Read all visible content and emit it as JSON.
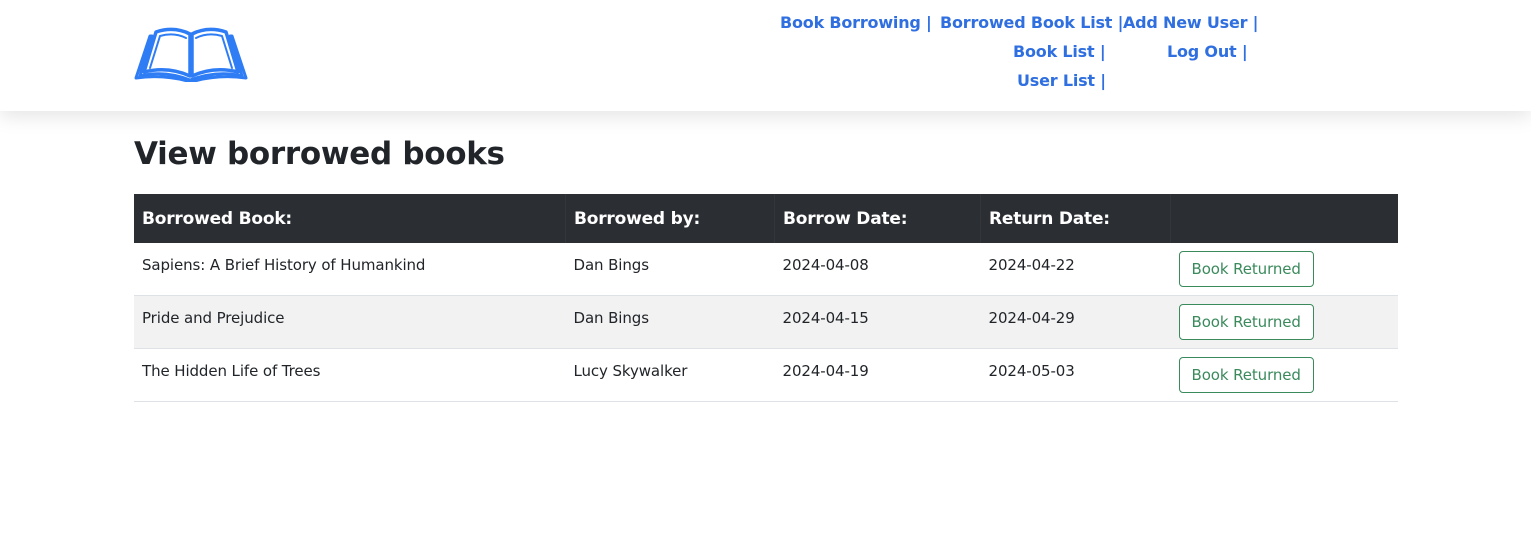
{
  "colors": {
    "nav_link": "#2f6fe0",
    "logo": "#2f7df5",
    "table_header_bg": "#2b2f33",
    "button_border": "#3a8a5c"
  },
  "header": {
    "logo_icon": "open-book-icon",
    "nav": {
      "book_borrowing": "Book Borrowing |",
      "borrowed_book_list": "Borrowed Book List |",
      "add_new_user": "Add New User |",
      "book_list": "Book List |",
      "log_out": "Log Out |",
      "user_list": "User List |"
    }
  },
  "page": {
    "title": "View borrowed books"
  },
  "table": {
    "headers": {
      "book": "Borrowed Book:",
      "borrowed_by": "Borrowed by:",
      "borrow_date": "Borrow Date:",
      "return_date": "Return Date:",
      "action": ""
    },
    "rows": [
      {
        "book": "Sapiens: A Brief History of Humankind",
        "borrowed_by": "Dan Bings",
        "borrow_date": "2024-04-08",
        "return_date": "2024-04-22",
        "action_label": "Book Returned"
      },
      {
        "book": "Pride and Prejudice",
        "borrowed_by": "Dan Bings",
        "borrow_date": "2024-04-15",
        "return_date": "2024-04-29",
        "action_label": "Book Returned"
      },
      {
        "book": "The Hidden Life of Trees",
        "borrowed_by": "Lucy Skywalker",
        "borrow_date": "2024-04-19",
        "return_date": "2024-05-03",
        "action_label": "Book Returned"
      }
    ]
  }
}
